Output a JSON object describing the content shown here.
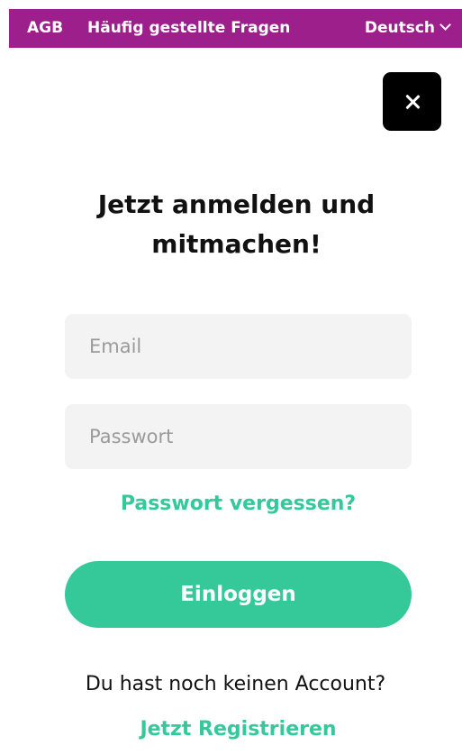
{
  "topbar": {
    "agb": "AGB",
    "faq": "Häufig gestellte Fragen",
    "language": "Deutsch",
    "language_icon": "chevron-down-icon"
  },
  "close_icon": "close-icon",
  "title_lines": [
    "Jetzt anmelden und",
    "mitmachen!"
  ],
  "form": {
    "email_placeholder": "Email",
    "email_value": "",
    "password_placeholder": "Passwort",
    "password_value": "",
    "forgot_password": "Passwort vergessen?",
    "login_label": "Einloggen"
  },
  "footer": {
    "no_account": "Du hast noch keinen Account?",
    "register": "Jetzt Registrieren"
  },
  "colors": {
    "brand_purple": "#9c1f8c",
    "accent_green": "#35c99a",
    "close_button": "#000000",
    "field_background": "#f3f3f3"
  }
}
